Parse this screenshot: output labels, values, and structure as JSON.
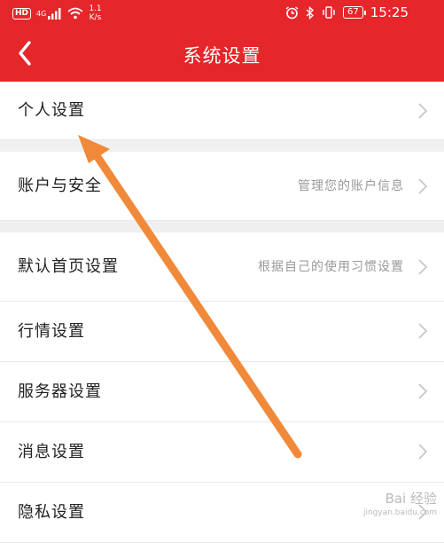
{
  "status_bar": {
    "network_badge": "HD",
    "network_type": "4G",
    "speed_value": "1.1",
    "speed_unit": "K/s",
    "battery": "67",
    "time": "15:25"
  },
  "header": {
    "title": "系统设置",
    "background_color": "#e5262a"
  },
  "rows": [
    {
      "label": "个人设置",
      "hint": ""
    },
    {
      "label": "账户与安全",
      "hint": "管理您的账户信息"
    },
    {
      "label": "默认首页设置",
      "hint": "根据自己的使用习惯设置"
    },
    {
      "label": "行情设置",
      "hint": ""
    },
    {
      "label": "服务器设置",
      "hint": ""
    },
    {
      "label": "消息设置",
      "hint": ""
    },
    {
      "label": "隐私设置",
      "hint": ""
    }
  ],
  "watermark": {
    "text": "Bai 经验",
    "sub": "jingyan.baidu.com"
  },
  "annotation": {
    "color": "#f08a3a"
  }
}
